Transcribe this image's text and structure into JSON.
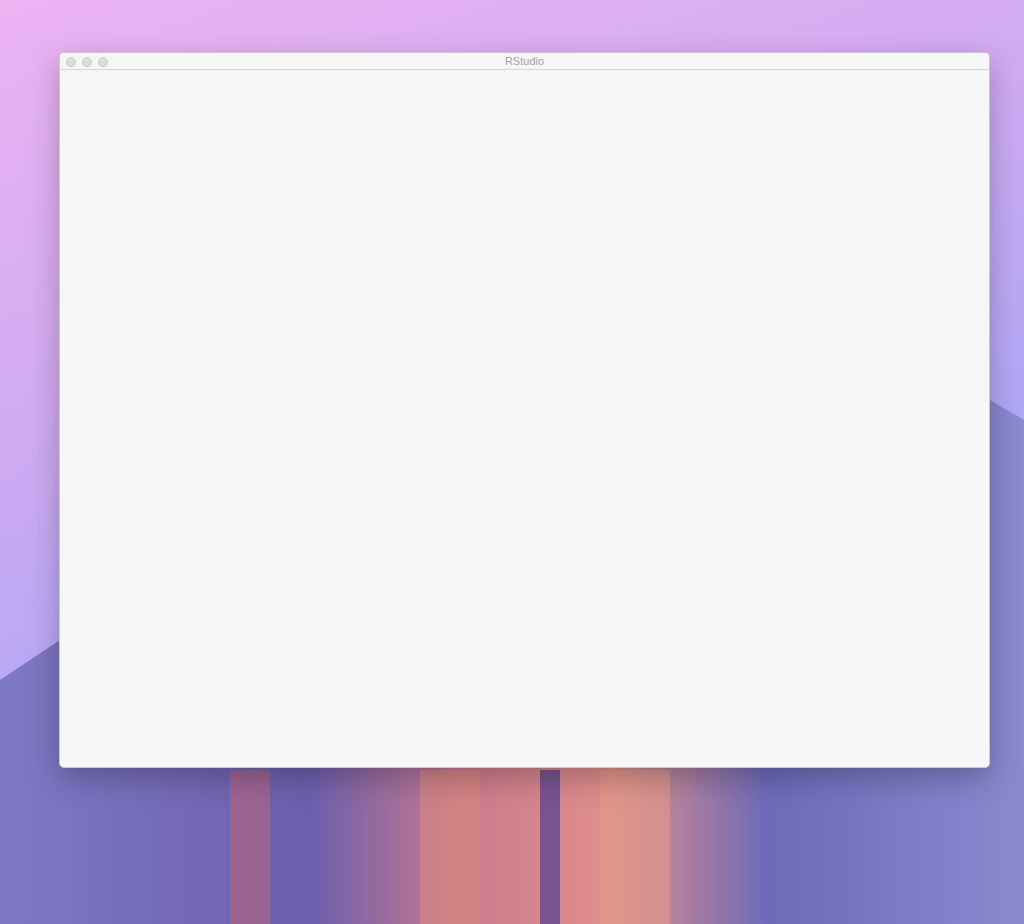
{
  "window": {
    "title": "RStudio",
    "focused": false
  }
}
